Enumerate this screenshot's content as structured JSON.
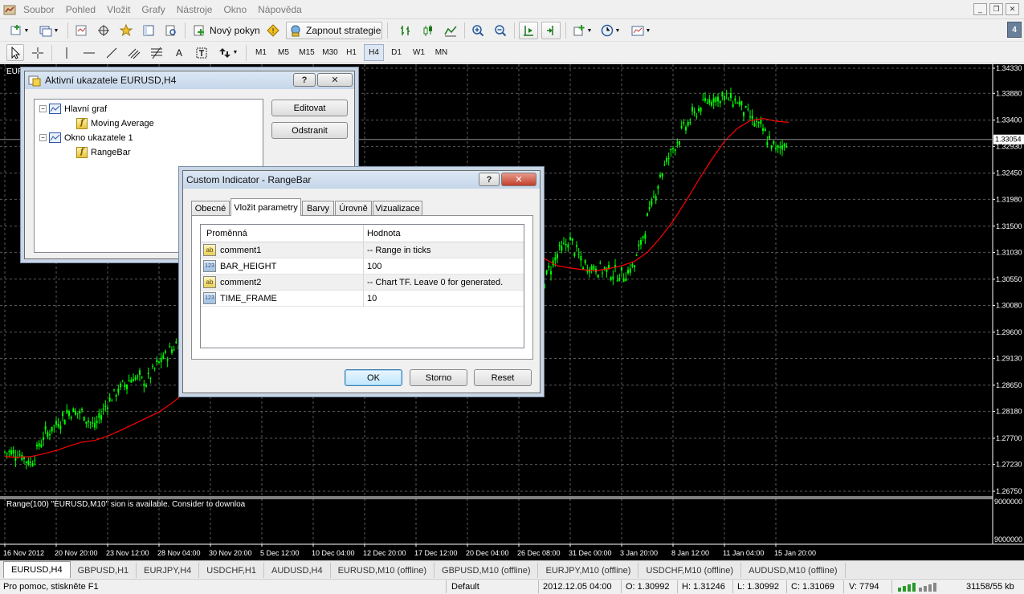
{
  "menu": {
    "items": [
      "Soubor",
      "Pohled",
      "Vložit",
      "Grafy",
      "Nástroje",
      "Okno",
      "Nápověda"
    ]
  },
  "toolbar": {
    "new_order_label": "Nový pokyn",
    "strategies_label": "Zapnout strategie",
    "timeframes": [
      "M1",
      "M5",
      "M15",
      "M30",
      "H1",
      "H4",
      "D1",
      "W1",
      "MN"
    ],
    "active_timeframe": "H4",
    "tab_badge": "4"
  },
  "chart": {
    "symbol_label": "EUR",
    "background": "#000000",
    "candle_color": "#00ff00",
    "ma_color": "#ff0000",
    "current_price": "1.33054",
    "price_levels": [
      "1.34330",
      "1.33880",
      "1.33400",
      "1.32930",
      "1.32450",
      "1.31980",
      "1.31500",
      "1.31030",
      "1.30550",
      "1.30080",
      "1.29600",
      "1.29130",
      "1.28650",
      "1.28180",
      "1.27700",
      "1.27230",
      "1.26750"
    ],
    "indicator_levels": [
      "9000000",
      "9000000"
    ],
    "indicator_text": "Range(100) \"EURUSD,M10\"  sion is available. Consider to downloa",
    "time_labels": [
      "16 Nov 2012",
      "20 Nov 20:00",
      "23 Nov 12:00",
      "28 Nov 04:00",
      "30 Nov 20:00",
      "5 Dec 12:00",
      "10 Dec 04:00",
      "12 Dec 20:00",
      "17 Dec 12:00",
      "20 Dec 04:00",
      "26 Dec 08:00",
      "31 Dec 00:00",
      "3 Jan 20:00",
      "8 Jan 12:00",
      "11 Jan 04:00",
      "15 Jan 20:00"
    ]
  },
  "chart_data": {
    "type": "candlestick",
    "series": [
      {
        "name": "EURUSD,H4",
        "values": [
          1.2745,
          1.2745,
          1.2725,
          1.2772,
          1.2795,
          1.2818,
          1.2815,
          1.279,
          1.2835,
          1.286,
          1.288,
          1.287,
          1.2905,
          1.293,
          1.2955,
          1.297,
          1.2965,
          1.294,
          1.2918,
          1.2945,
          1.293,
          1.296,
          1.3015,
          1.307,
          1.314,
          1.3215,
          1.3275,
          1.325,
          1.3215,
          1.324,
          1.324,
          1.32,
          1.321,
          1.319,
          1.3208,
          1.318,
          1.3235,
          1.318,
          1.315,
          1.31,
          1.306,
          1.304,
          1.3055,
          1.31,
          1.3125,
          1.308,
          1.3075,
          1.307,
          1.306,
          1.308,
          1.316,
          1.324,
          1.329,
          1.333,
          1.336,
          1.338,
          1.338,
          1.3375,
          1.3345,
          1.332,
          1.3285,
          1.3305
        ]
      },
      {
        "name": "Moving Average",
        "values": [
          1.2737,
          1.2736,
          1.2737,
          1.2742,
          1.2748,
          1.2756,
          1.2763,
          1.2766,
          1.2774,
          1.2784,
          1.2795,
          1.2806,
          1.2817,
          1.2833,
          1.2852,
          1.2874,
          1.2893,
          1.2906,
          1.2913,
          1.2923,
          1.2928,
          1.2935,
          1.2952,
          1.2975,
          1.3009,
          1.3047,
          1.3088,
          1.3134,
          1.3172,
          1.3201,
          1.3222,
          1.3228,
          1.3234,
          1.3231,
          1.3224,
          1.3216,
          1.3209,
          1.3198,
          1.3182,
          1.316,
          1.3137,
          1.3113,
          1.3092,
          1.3079,
          1.3075,
          1.3072,
          1.307,
          1.3074,
          1.3079,
          1.3087,
          1.3103,
          1.3129,
          1.3159,
          1.3195,
          1.3233,
          1.3269,
          1.3302,
          1.3325,
          1.3339,
          1.3343,
          1.3338,
          1.3336
        ]
      }
    ],
    "ylim": [
      1.2675,
      1.3433
    ],
    "x": [
      "16 Nov 2012",
      "20 Nov 20:00",
      "23 Nov 12:00",
      "28 Nov 04:00",
      "30 Nov 20:00",
      "5 Dec 12:00",
      "10 Dec 04:00",
      "12 Dec 20:00",
      "17 Dec 12:00",
      "20 Dec 04:00",
      "26 Dec 08:00",
      "31 Dec 00:00",
      "3 Jan 20:00",
      "8 Jan 12:00",
      "11 Jan 04:00",
      "15 Jan 20:00"
    ],
    "grid": true
  },
  "indicators_dialog": {
    "title": "Aktivní ukazatele EURUSD,H4",
    "help": "?",
    "close": "✕",
    "tree": [
      "Hlavní graf",
      "Moving Average",
      "Okno ukazatele 1",
      "RangeBar"
    ],
    "edit_label": "Editovat",
    "remove_label": "Odstranit"
  },
  "custom_dialog": {
    "title": "Custom Indicator - RangeBar",
    "help": "?",
    "close": "✕",
    "tabs": [
      "Obecné",
      "Vložit parametry",
      "Barvy",
      "Úrovně",
      "Vizualizace"
    ],
    "active_tab": "Vložit parametry",
    "col_variable": "Proměnná",
    "col_value": "Hodnota",
    "params": [
      {
        "type": "ab",
        "name": "comment1",
        "value": "--   Range in ticks"
      },
      {
        "type": "123",
        "name": "BAR_HEIGHT",
        "value": "100"
      },
      {
        "type": "ab",
        "name": "comment2",
        "value": "--   Chart TF. Leave 0 for generated."
      },
      {
        "type": "123",
        "name": "TIME_FRAME",
        "value": "10"
      }
    ],
    "ok_label": "OK",
    "cancel_label": "Storno",
    "reset_label": "Reset"
  },
  "tabs": [
    "EURUSD,H4",
    "GBPUSD,H1",
    "EURJPY,H4",
    "USDCHF,H1",
    "AUDUSD,H4",
    "EURUSD,M10 (offline)",
    "GBPUSD,M10 (offline)",
    "EURJPY,M10 (offline)",
    "USDCHF,M10 (offline)",
    "AUDUSD,M10 (offline)"
  ],
  "status": {
    "help": "Pro pomoc, stiskněte F1",
    "profile": "Default",
    "datetime": "2012.12.05 04:00",
    "open": "O: 1.30992",
    "high": "H: 1.31246",
    "low": "L: 1.30992",
    "close": "C: 1.31069",
    "volume": "V: 7794",
    "traffic": "31158/55 kb"
  }
}
